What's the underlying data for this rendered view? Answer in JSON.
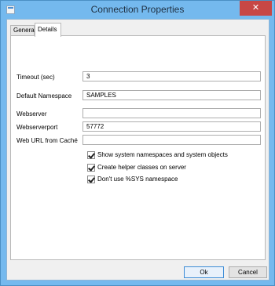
{
  "window": {
    "title": "Connection Properties",
    "close_glyph": "✕"
  },
  "tabs": [
    {
      "label": "General",
      "active": false
    },
    {
      "label": "Details",
      "active": true
    }
  ],
  "fields": {
    "timeout": {
      "label": "Timeout (sec)",
      "value": "3"
    },
    "default_namespace": {
      "label": "Default Namespace",
      "value": "SAMPLES"
    },
    "webserver": {
      "label": "Webserver",
      "value": ""
    },
    "webserverport": {
      "label": "Webserverport",
      "value": "57772"
    },
    "web_url": {
      "label": "Web URL from Caché",
      "value": ""
    }
  },
  "options": [
    {
      "label": "Show system namespaces and system objects",
      "checked": true
    },
    {
      "label": "Create helper classes on server",
      "checked": true
    },
    {
      "label": "Don't use %SYS namespace",
      "checked": true
    }
  ],
  "buttons": {
    "ok": "Ok",
    "cancel": "Cancel"
  }
}
